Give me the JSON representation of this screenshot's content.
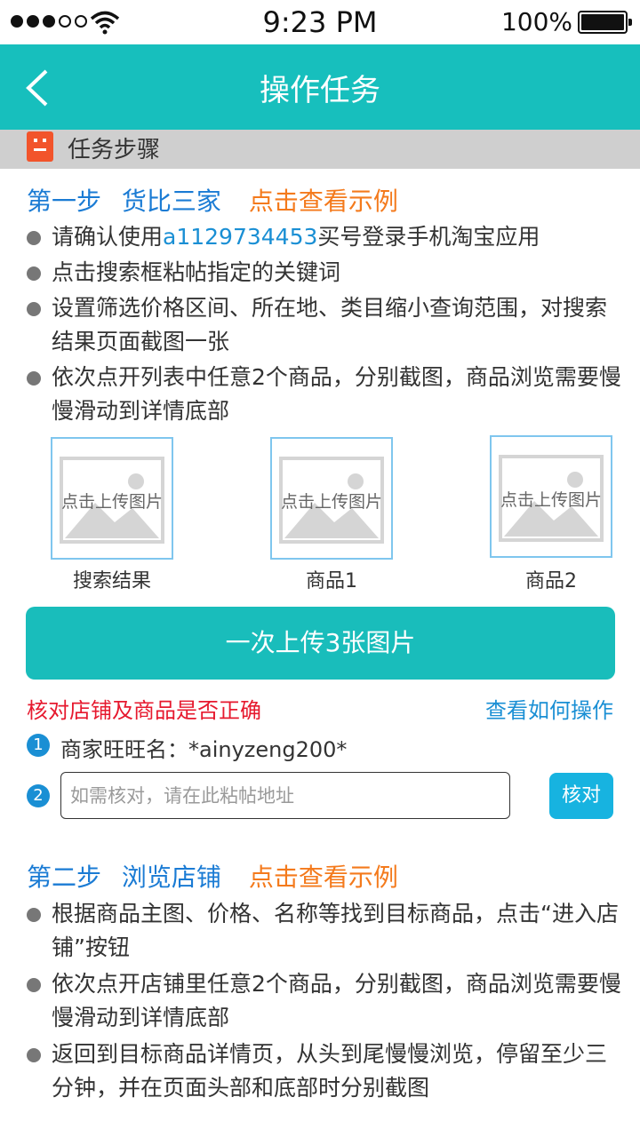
{
  "status_bar": {
    "time": "9:23 PM",
    "battery": "100%"
  },
  "header": {
    "title": "操作任务"
  },
  "section": {
    "title": "任务步骤"
  },
  "step1": {
    "label": "第一步",
    "name": "货比三家",
    "example_link": "点击查看示例",
    "bullets": [
      {
        "pre": "请确认使用",
        "account": "a1129734453",
        "post": "买号登录手机淘宝应用"
      },
      {
        "text": "点击搜索框粘帖指定的关键词"
      },
      {
        "text": "设置筛选价格区间、所在地、类目缩小查询范围，对搜索结果页面截图一张"
      },
      {
        "text": "依次点开列表中任意2个商品，分别截图，商品浏览需要慢慢滑动到详情底部"
      }
    ],
    "uploads": [
      {
        "caption": "点击上传图片",
        "label": "搜索结果"
      },
      {
        "caption": "点击上传图片",
        "label": "商品1"
      },
      {
        "caption": "点击上传图片",
        "label": "商品2"
      }
    ],
    "upload_button": "一次上传3张图片"
  },
  "verify": {
    "title": "核对店铺及商品是否正确",
    "howto_link": "查看如何操作",
    "num1": "1",
    "num2": "2",
    "shop_label": "商家旺旺名：*ainyzeng200*",
    "address_placeholder": "如需核对，请在此粘帖地址",
    "check_button": "核对"
  },
  "step2": {
    "label": "第二步",
    "name": "浏览店铺",
    "example_link": "点击查看示例",
    "bullets": [
      {
        "text": "根据商品主图、价格、名称等找到目标商品，点击“进入店铺”按钮"
      },
      {
        "text": "依次点开店铺里任意2个商品，分别截图，商品浏览需要慢慢滑动到详情底部"
      },
      {
        "text": "返回到目标商品详情页，从头到尾慢慢浏览，停留至少三分钟，并在页面头部和底部时分别截图"
      }
    ]
  },
  "colors": {
    "accent": "#17bfbd",
    "link": "#1a8fd4",
    "warning": "#e6192e",
    "orange": "#f47a1c"
  }
}
